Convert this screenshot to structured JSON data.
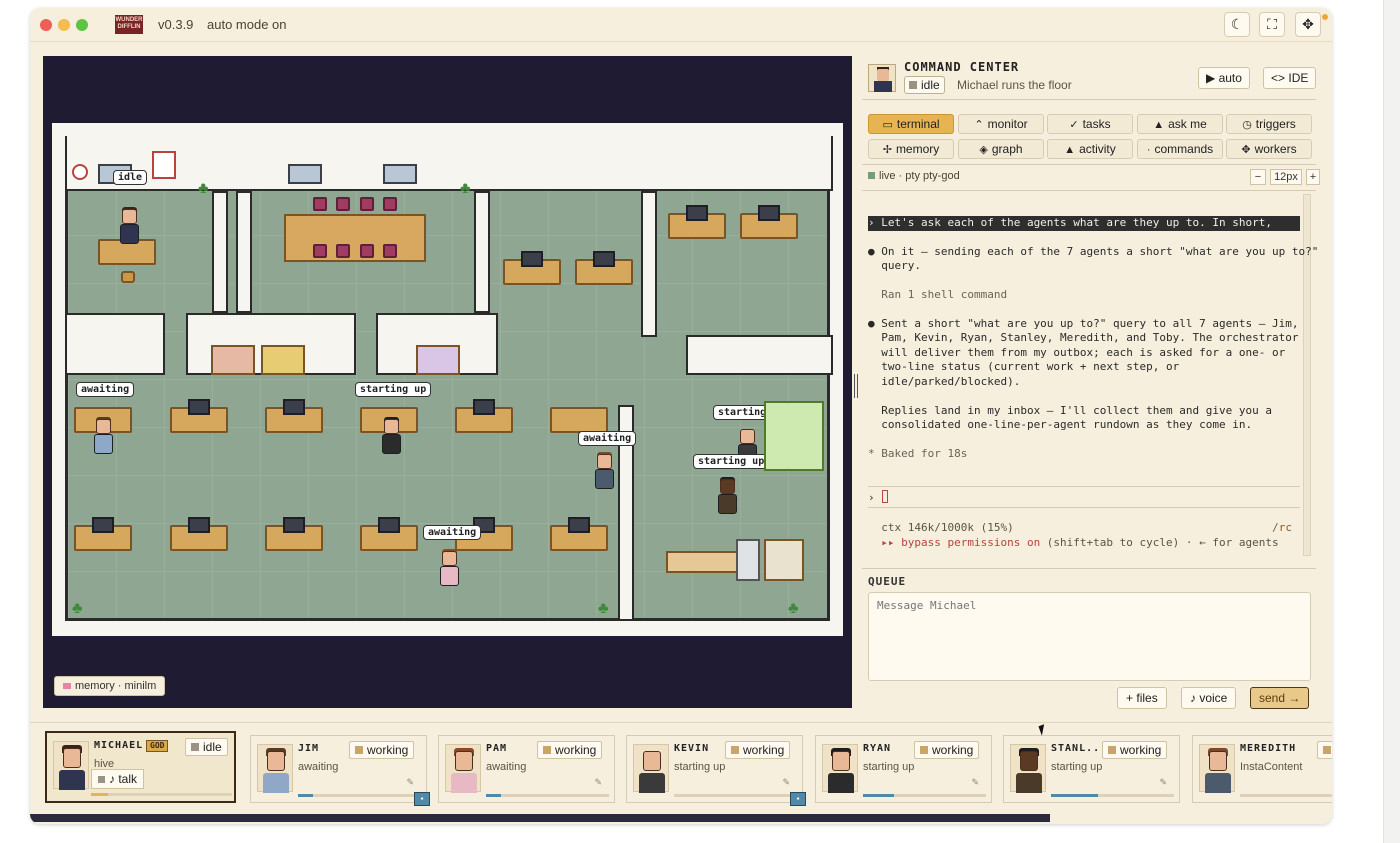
{
  "titlebar": {
    "logo_text": "WUNDER DIFFLIN",
    "version": "v0.3.9",
    "mode": "auto mode on",
    "icons": [
      "moon-icon",
      "expand-icon",
      "gear-icon"
    ]
  },
  "game": {
    "bubbles": {
      "michael": "idle",
      "jim": "awaiting",
      "pam": "awaiting",
      "kevin": "starting up",
      "ryan": "starting up",
      "stanley": "starting up",
      "meredith": "awaiting"
    },
    "memory_badge": "memory · minilm"
  },
  "command_center": {
    "title": "COMMAND CENTER",
    "status": "idle",
    "subtitle": "Michael runs the floor",
    "auto_label": "auto",
    "ide_label": "IDE",
    "tabs": [
      {
        "label": "terminal",
        "icon": "terminal-icon",
        "active": true
      },
      {
        "label": "monitor",
        "icon": "monitor-icon"
      },
      {
        "label": "tasks",
        "icon": "check-icon"
      },
      {
        "label": "ask me",
        "icon": "bell-icon"
      },
      {
        "label": "triggers",
        "icon": "clock-icon"
      },
      {
        "label": "memory",
        "icon": "sparkle-icon"
      },
      {
        "label": "graph",
        "icon": "graph-icon"
      },
      {
        "label": "activity",
        "icon": "bell-icon"
      },
      {
        "label": "commands",
        "icon": "dot-icon"
      },
      {
        "label": "workers",
        "icon": "workers-icon"
      }
    ],
    "live_label": "live · pty pty-god",
    "font_size": "12px",
    "terminal": {
      "prompt": "› Let's ask each of the agents what are they up to. In short,",
      "line1a": "● On it — sending each of the 7 agents a short \"what are you up to?\"",
      "line1b": "  query.",
      "line2": "  Ran 1 shell command",
      "line3a": "● Sent a short \"what are you up to?\" query to all 7 agents — Jim,",
      "line3b": "  Pam, Kevin, Ryan, Stanley, Meredith, and Toby. The orchestrator",
      "line3c": "  will deliver them from my outbox; each is asked for a one- or",
      "line3d": "  two-line status (current work + next step, or",
      "line3e": "  idle/parked/blocked).",
      "line4a": "  Replies land in my inbox — I'll collect them and give you a",
      "line4b": "  consolidated one-line-per-agent rundown as they come in.",
      "line5": "* Baked for 18s",
      "caret": "›",
      "ctx": "  ctx 146k/1000k (15%)",
      "rc": "/rc",
      "bypass_strong": "  ▸▸ bypass permissions on",
      "bypass_rest": " (shift+tab to cycle) · ← for agents"
    },
    "queue_label": "QUEUE",
    "queue_placeholder": "Message Michael",
    "files_label": "files",
    "voice_label": "voice",
    "send_label": "send"
  },
  "agents": [
    {
      "name": "MICHAEL",
      "badge": "GOD",
      "status": "idle",
      "desc": "hive",
      "talk": "talk",
      "progress": 0.12
    },
    {
      "name": "JIM",
      "status": "working",
      "desc": "awaiting",
      "progress": 0.12
    },
    {
      "name": "PAM",
      "status": "working",
      "desc": "awaiting",
      "progress": 0.12
    },
    {
      "name": "KEVIN",
      "status": "working",
      "desc": "starting up",
      "progress": 0.0
    },
    {
      "name": "RYAN",
      "status": "working",
      "desc": "starting up",
      "progress": 0.25
    },
    {
      "name": "STANL...",
      "status": "working",
      "desc": "starting up",
      "progress": 0.38
    },
    {
      "name": "MEREDITH",
      "status": "",
      "desc": "InstaContent",
      "progress": 0.0
    }
  ],
  "colors": {
    "window_bg": "#f6efdd",
    "active_tab": "#e6b552",
    "game_bg": "#1f1b33",
    "floor": "#8ea692",
    "accent_red": "#b8433f"
  }
}
